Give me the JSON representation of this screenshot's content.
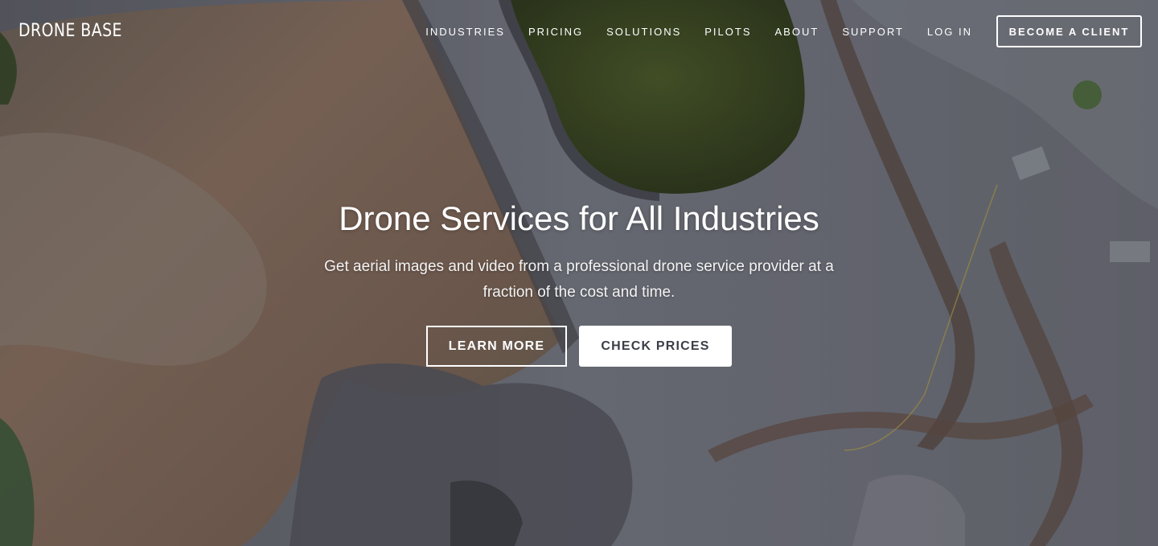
{
  "header": {
    "logo_text": "DRONE BASE",
    "nav": [
      {
        "label": "INDUSTRIES"
      },
      {
        "label": "PRICING"
      },
      {
        "label": "SOLUTIONS"
      },
      {
        "label": "PILOTS"
      },
      {
        "label": "ABOUT"
      },
      {
        "label": "SUPPORT"
      },
      {
        "label": "LOG IN"
      }
    ],
    "cta_label": "BECOME A CLIENT"
  },
  "hero": {
    "headline": "Drone Services for All Industries",
    "subtitle": "Get aerial images and video from a professional drone service provider at a fraction of the cost and time.",
    "learn_more_label": "LEARN MORE",
    "check_prices_label": "CHECK PRICES",
    "background": "aerial-quarry-photo"
  },
  "colors": {
    "text": "#ffffff",
    "button_text_dark": "#3a3e47",
    "pond_green": "#3f4b26",
    "water_brown": "#7a6452",
    "gravel_gray": "#6b6e78"
  }
}
